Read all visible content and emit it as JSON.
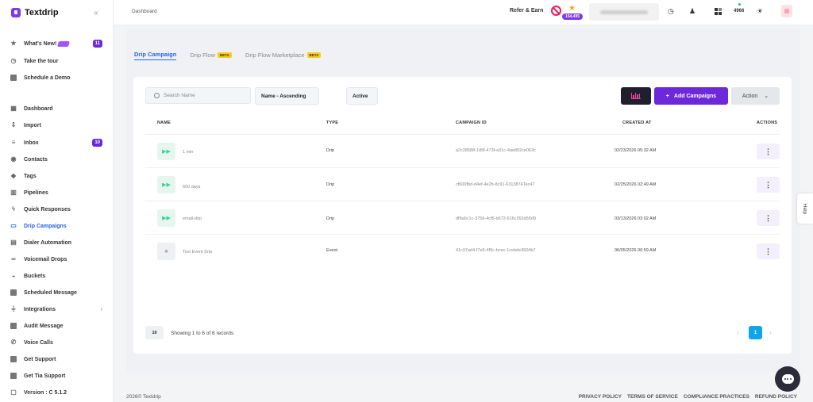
{
  "app": {
    "name": "Textdrip"
  },
  "sidebar": {
    "collapse_icon": "double-chevron-left-icon",
    "items": [
      {
        "label": "What's New!",
        "icon": "star-icon",
        "count": "11"
      },
      {
        "label": "Take the tour",
        "icon": "clock-icon"
      },
      {
        "label": "Schedule a Demo",
        "icon": "calendar-icon"
      },
      {
        "label": "Dashboard",
        "icon": "dashboard-icon"
      },
      {
        "label": "Import",
        "icon": "import-icon"
      },
      {
        "label": "Inbox",
        "icon": "inbox-icon",
        "count": "10"
      },
      {
        "label": "Contacts",
        "icon": "contacts-icon"
      },
      {
        "label": "Tags",
        "icon": "tag-icon"
      },
      {
        "label": "Pipelines",
        "icon": "pipeline-icon"
      },
      {
        "label": "Quick Responses",
        "icon": "bolt-icon"
      },
      {
        "label": "Drip Campaigns",
        "icon": "drip-icon"
      },
      {
        "label": "Dialer Automation",
        "icon": "dialer-icon"
      },
      {
        "label": "Voicemail Drops",
        "icon": "voicemail-icon"
      },
      {
        "label": "Buckets",
        "icon": "bucket-icon"
      },
      {
        "label": "Scheduled Message",
        "icon": "scheduled-icon"
      },
      {
        "label": "Integrations",
        "icon": "plug-icon"
      },
      {
        "label": "Audit Message",
        "icon": "audit-icon"
      },
      {
        "label": "Voice Calls",
        "icon": "phone-icon"
      },
      {
        "label": "Get Support",
        "icon": "support-icon"
      },
      {
        "label": "Get Tia Support",
        "icon": "chat-icon"
      },
      {
        "label": "Version : C 5.1.2",
        "icon": "version-icon"
      }
    ]
  },
  "header": {
    "breadcrumb": "Dashboard",
    "refer_label": "Refer & Earn",
    "credits": "154,495",
    "number": "4966"
  },
  "tabs": [
    {
      "label": "Drip Campaign",
      "active": true
    },
    {
      "label": "Drip Flow",
      "badge": "BETA"
    },
    {
      "label": "Drip Flow Marketplace",
      "badge": "BETA"
    }
  ],
  "toolbar": {
    "search_placeholder": "Search Name",
    "sort_value": "Name - Ascending",
    "status_value": "Active",
    "add_label": "Add Campaigns",
    "action_label": "Action"
  },
  "table": {
    "headers": {
      "name": "NAME",
      "type": "TYPE",
      "campaign_id": "CAMPAIGN ID",
      "created_at": "CREATED AT",
      "actions": "ACTIONS"
    },
    "rows": [
      {
        "name": "1 min",
        "type": "Drip",
        "campaign_id": "a2c28588-1d9f-473f-a31c-4ae892ce063c",
        "created_at": "02/23/2026 05:32 AM"
      },
      {
        "name": "600 days",
        "type": "Drip",
        "campaign_id": "cf600fbd-d4ef-4e2b-8c91-6313874Tec47",
        "created_at": "02/25/2026 02:49 AM"
      },
      {
        "name": "email-drip",
        "type": "Drip",
        "campaign_id": "df6a6c1c-3756-4cf6-b672-616c263d56d9",
        "created_at": "03/13/2026 03:02 AM"
      },
      {
        "name": "Test Event Drip",
        "type": "Event",
        "campaign_id": "41c97ad4-f7e5-4f9c-bcec-1cebde3604b7",
        "created_at": "06/05/2026 06:59 AM"
      }
    ]
  },
  "pagination": {
    "page_size": "10",
    "records": "Showing 1 to 6 of 6 records",
    "current": "1"
  },
  "help_label": "Help",
  "footer": {
    "copyright": "2026© Textdrip",
    "links": [
      "PRIVACY POLICY",
      "TERMS OF SERVICE",
      "COMPLIANCE PRACTICES",
      "REFUND POLICY"
    ]
  },
  "colors": {
    "brand": "#7c3aed",
    "active": "#2563eb",
    "pagination": "#0ea5e9"
  }
}
